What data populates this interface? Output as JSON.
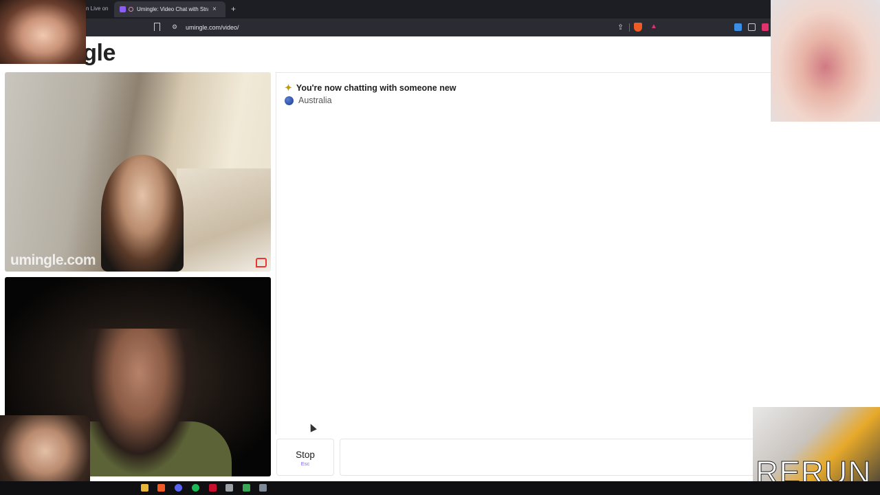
{
  "browser": {
    "prev_tab_title": "n Live on",
    "active_tab_title": "Umingle: Video Chat with Stra",
    "new_tab_symbol": "+",
    "close_symbol": "×",
    "url": "umingle.com/video/"
  },
  "page": {
    "logo_text": "ngle",
    "watermark": "umingle.com"
  },
  "chat": {
    "status_message": "You're now chatting with someone new",
    "country": "Australia"
  },
  "controls": {
    "stop_label": "Stop",
    "stop_hint": "Esc",
    "message_placeholder": ""
  },
  "overlay": {
    "rerun_text": "RERUN"
  },
  "colors": {
    "accent": "#7a6cf0",
    "report": "#ee3333",
    "browser_dark": "#1d1d24"
  },
  "icons": [
    "bookmark-icon",
    "site-settings-icon",
    "share-icon",
    "brave-shield-icon",
    "brave-rewards-icon",
    "download-icon",
    "wallet-icon",
    "extension-icon",
    "sparkle-icon",
    "flag-icon",
    "report-flag-icon"
  ]
}
